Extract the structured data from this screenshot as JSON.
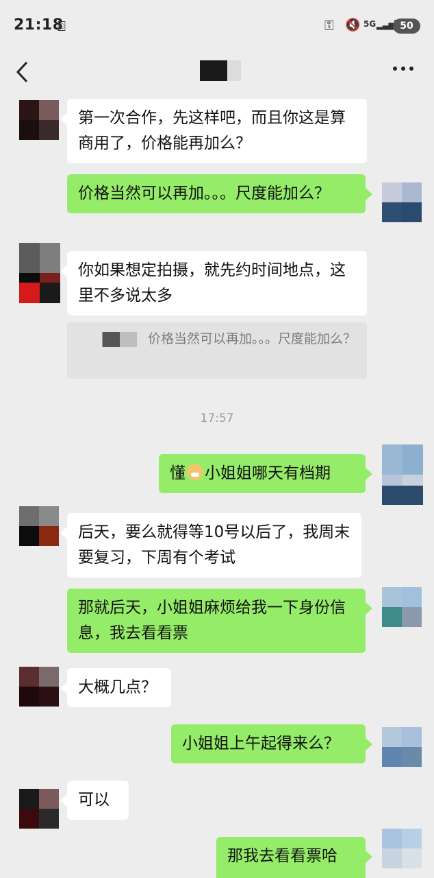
{
  "status_bar": {
    "time": "21:18",
    "network": "5G",
    "battery": "50"
  },
  "nav": {
    "back_icon": "chevron-left-icon",
    "more_icon": "more-dots-icon"
  },
  "messages": [
    {
      "side": "left",
      "text": "第一次合作，先这样吧，而且你这是算商用了，价格能再加么？"
    },
    {
      "side": "right",
      "text": "价格当然可以再加。。。尺度能加么？"
    },
    {
      "side": "left",
      "text": "你如果想定拍摄，就先约时间地点，这里不多说太多"
    },
    {
      "side": "right",
      "text_before": "懂",
      "text_after": "小姐姐哪天有档期"
    },
    {
      "side": "left",
      "text": "后天，要么就得等10号以后了，我周末要复习，下周有个考试"
    },
    {
      "side": "right",
      "text": "那就后天，小姐姐麻烦给我一下身份信息，我去看看票"
    },
    {
      "side": "left",
      "text": "大概几点？"
    },
    {
      "side": "right",
      "text": "小姐姐上午起得来么？"
    },
    {
      "side": "left",
      "text": "可以"
    },
    {
      "side": "right",
      "text": "那我去看看票哈"
    }
  ],
  "quote": {
    "text": "价格当然可以再加。。。尺度能加么？"
  },
  "timestamp": "17:57",
  "colors": {
    "background": "#ededed",
    "bubble_self": "#95ec69",
    "bubble_other": "#ffffff"
  }
}
